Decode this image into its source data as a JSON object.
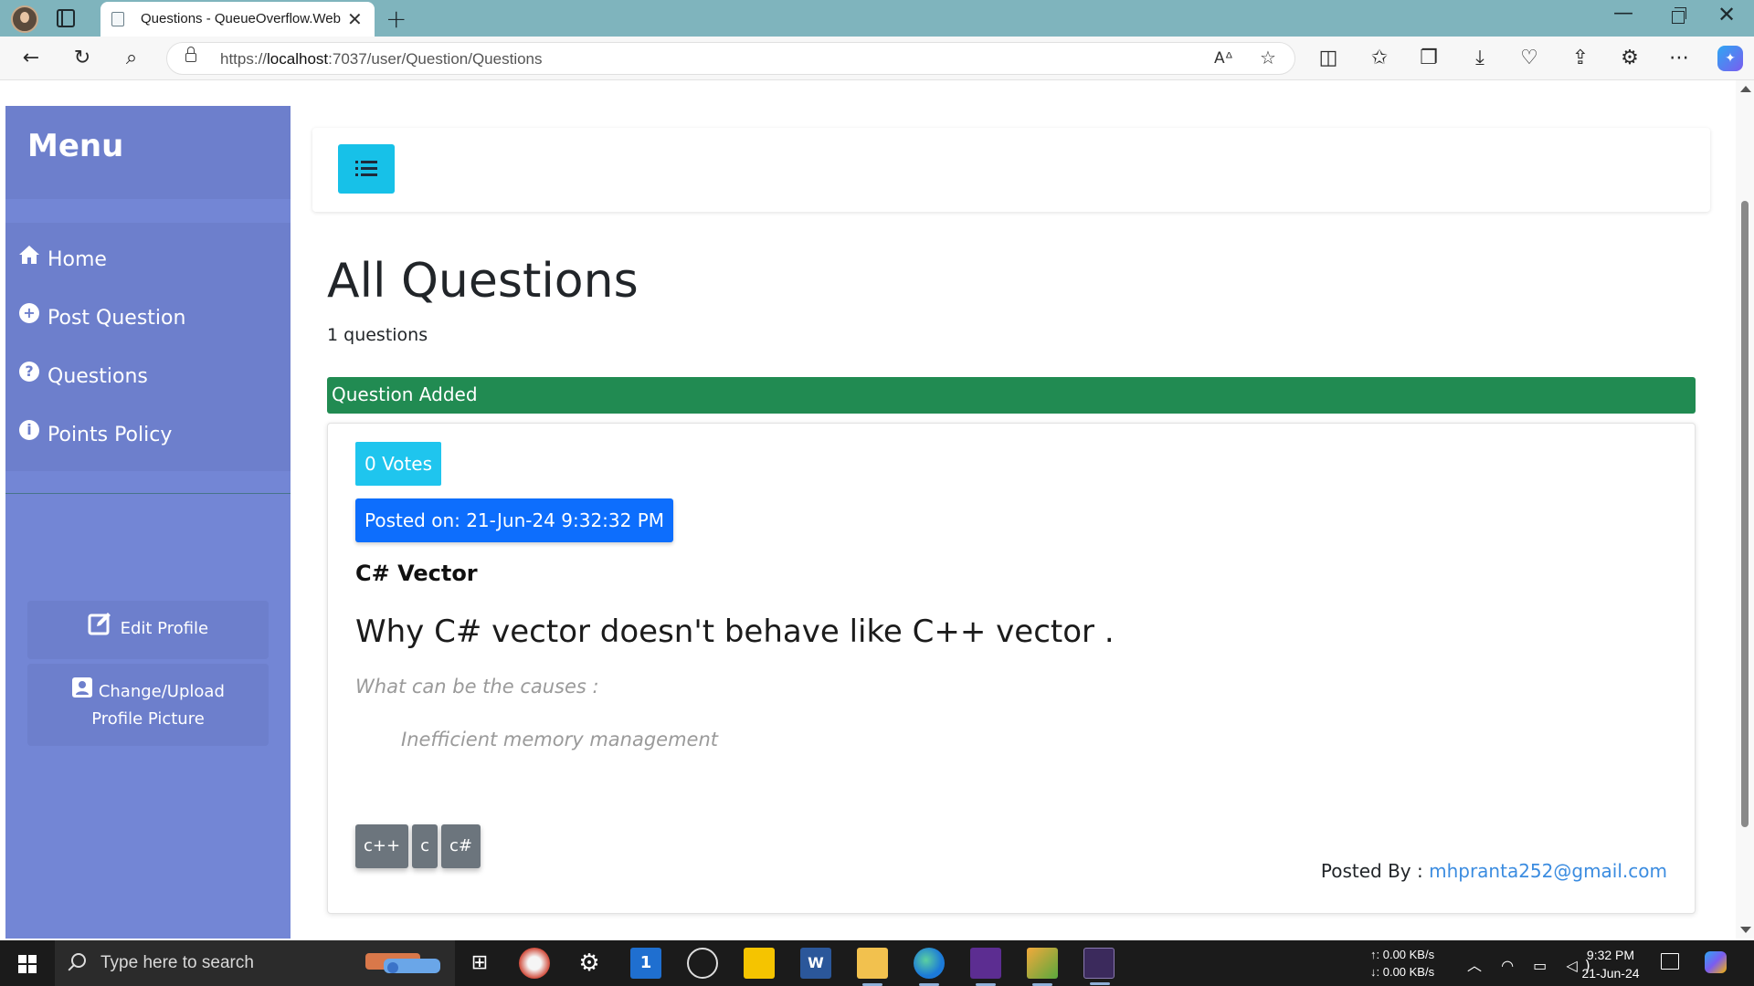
{
  "browser": {
    "tab_title": "Questions - QueueOverflow.Web",
    "url_prefix": "https://",
    "url_host": "localhost",
    "url_path": ":7037/user/Question/Questions"
  },
  "sidebar": {
    "title": "Menu",
    "items": [
      {
        "label": "Home",
        "icon": "home-icon"
      },
      {
        "label": "Post Question",
        "icon": "plus-circle-icon"
      },
      {
        "label": "Questions",
        "icon": "question-circle-icon"
      },
      {
        "label": "Points Policy",
        "icon": "info-circle-icon"
      }
    ],
    "edit_profile_label": "Edit Profile",
    "change_picture_line1": "Change/Upload",
    "change_picture_line2": "Profile Picture"
  },
  "main": {
    "title": "All Questions",
    "question_count": "1 questions",
    "alert": "Question Added",
    "question": {
      "votes": "0 Votes",
      "posted_on": "Posted on: 21-Jun-24 9:32:32 PM",
      "title": "C# Vector",
      "heading": "Why C# vector doesn't behave like C++ vector .",
      "sub": "What can be the causes :",
      "item": "Inefficient memory management",
      "tags": [
        "c++",
        "c",
        "c#"
      ],
      "posted_by_label": "Posted By : ",
      "posted_by_email": "mhpranta252@gmail.com"
    }
  },
  "taskbar": {
    "search_placeholder": "Type here to search",
    "upload_speed": "↑: 0.00 KB/s",
    "download_speed": "↓: 0.00 KB/s",
    "time": "9:32 PM",
    "date": "21-Jun-24"
  },
  "colors": {
    "sidebar_bg": "#7386d5",
    "sidebar_header_bg": "#6d7fcc",
    "toggle_cyan": "#17c1e8",
    "alert_green": "#218b52",
    "votes_cyan": "#1fc5ee",
    "posted_on_blue": "#0d6efd",
    "tag_gray": "#6c757d",
    "email_link": "#3b8ce0"
  }
}
